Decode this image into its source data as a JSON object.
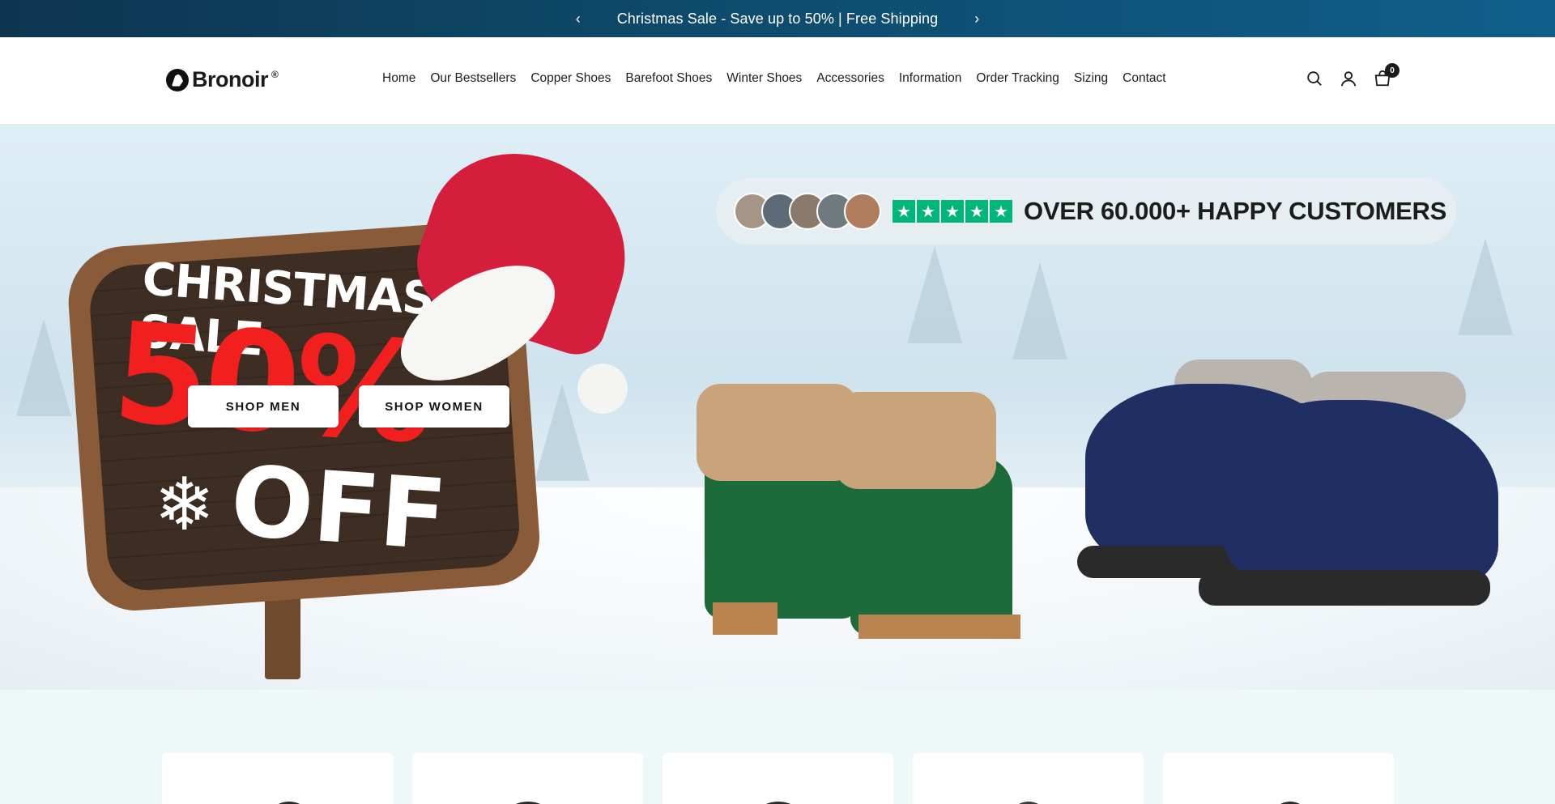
{
  "announcement": {
    "prev_arrow": "‹",
    "message": "Christmas Sale - Save up to 50% | Free Shipping",
    "next_arrow": "›"
  },
  "header": {
    "logo_text": "Bronoir",
    "logo_registered": "®",
    "nav": [
      {
        "label": "Home"
      },
      {
        "label": "Our Bestsellers"
      },
      {
        "label": "Copper Shoes"
      },
      {
        "label": "Barefoot Shoes"
      },
      {
        "label": "Winter Shoes"
      },
      {
        "label": "Accessories"
      },
      {
        "label": "Information"
      },
      {
        "label": "Order Tracking"
      },
      {
        "label": "Sizing"
      },
      {
        "label": "Contact"
      }
    ],
    "icons": [
      "search-icon",
      "account-icon",
      "cart-icon"
    ],
    "cart_count": "0"
  },
  "hero": {
    "sign_title": "CHRISTMAS SALE",
    "sign_percent": "50%",
    "sign_off": "OFF",
    "snowflake": "❄",
    "review_text": "OVER 60.000+ HAPPY CUSTOMERS",
    "stars": [
      "★",
      "★",
      "★",
      "★",
      "★"
    ],
    "rating_color": "#00b67a",
    "shop_men": "SHOP MEN",
    "shop_women": "SHOP WOMEN"
  },
  "colors": {
    "announcement_bg": "#0e4a6c",
    "sale_red": "#f21f1f",
    "page_bg": "#eef8f8"
  },
  "product_cards": [
    {
      "image": "shoe"
    },
    {
      "image": "shoe"
    },
    {
      "image": "shoe"
    },
    {
      "image": "shoe"
    },
    {
      "image": "shoe"
    }
  ]
}
